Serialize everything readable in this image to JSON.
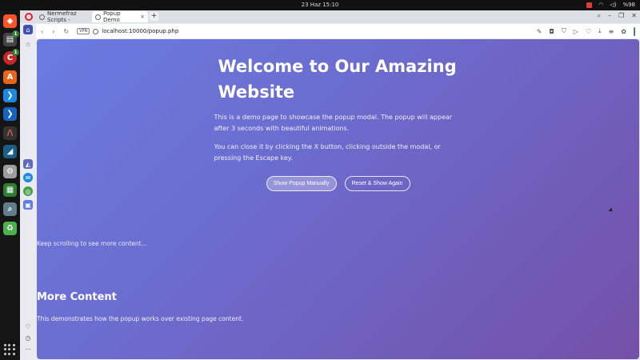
{
  "topbar": {
    "clock": "23 Haz  15:10",
    "battery": "%98"
  },
  "browser": {
    "tabs": [
      {
        "label": "Nermefraz Scripts -"
      },
      {
        "label": "Popup Demo",
        "close": "×"
      }
    ],
    "new_tab": "+",
    "url": "localhost:10000/popup.php",
    "vpn": "VPN"
  },
  "page": {
    "title": "Welcome to Our Amazing Website",
    "intro": "This is a demo page to showcase the popup modal. The popup will appear after 3 seconds with beautiful animations.",
    "close_info": "You can close it by clicking the X button, clicking outside the modal, or pressing the Escape key.",
    "buttons": {
      "show": "Show Popup Manually",
      "reset": "Reset & Show Again"
    },
    "scroll_hint": "Keep scrolling to see more content...",
    "more_title": "More Content",
    "more_text": "This demonstrates how the popup works over existing page content."
  },
  "colors": {
    "gradient_start": "#6a7be0",
    "gradient_end": "#7450a8",
    "opera_red": "#e0202a"
  }
}
